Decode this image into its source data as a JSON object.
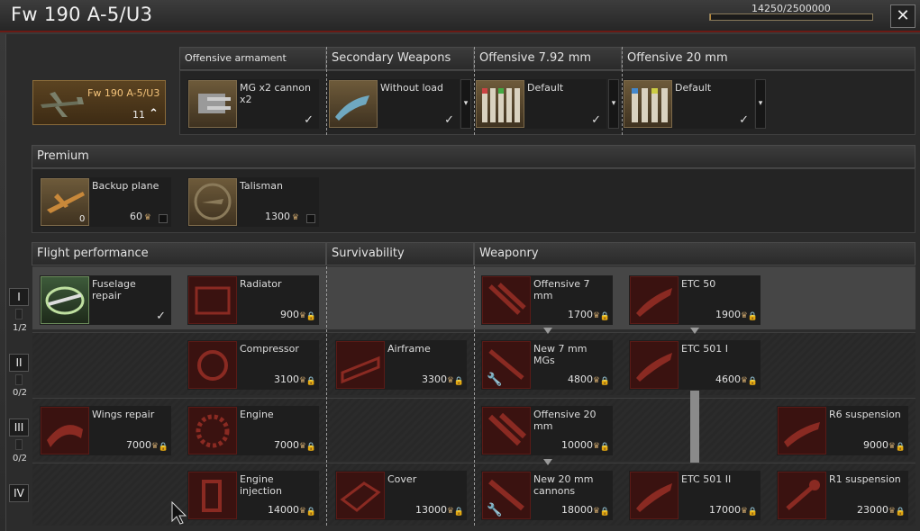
{
  "title": "Fw 190 A-5/U3",
  "xp": {
    "text": "14250/2500000",
    "fraction": 0.0057
  },
  "close_label": "✕",
  "plane": {
    "name": "Fw 190 A-5/U3",
    "rank": "11"
  },
  "weapons_headers": [
    "Offensive armament",
    "Secondary Weapons",
    "Offensive 7.92 mm",
    "Offensive 20 mm"
  ],
  "weapons": [
    {
      "name": "MG x2 cannon x2"
    },
    {
      "name": "Without load"
    },
    {
      "name": "Default"
    },
    {
      "name": "Default"
    }
  ],
  "premium": {
    "header": "Premium",
    "items": [
      {
        "name": "Backup plane",
        "cost": "60",
        "count": "0"
      },
      {
        "name": "Talisman",
        "cost": "1300"
      }
    ]
  },
  "modifications": {
    "headers": [
      "Flight performance",
      "Survivability",
      "Weaponry"
    ],
    "tiers": [
      "I",
      "II",
      "III",
      "IV"
    ],
    "tier_progress": [
      "1/2",
      "0/2",
      "0/2"
    ],
    "items": [
      {
        "name": "Fuselage repair",
        "cost": ""
      },
      {
        "name": "Radiator",
        "cost": "900"
      },
      {
        "name": "Offensive 7 mm",
        "cost": "1700"
      },
      {
        "name": "ETC 50",
        "cost": "1900"
      },
      {
        "name": "Compressor",
        "cost": "3100"
      },
      {
        "name": "Airframe",
        "cost": "3300"
      },
      {
        "name": "New 7 mm MGs",
        "cost": "4800"
      },
      {
        "name": "ETC 501 I",
        "cost": "4600"
      },
      {
        "name": "Wings repair",
        "cost": "7000"
      },
      {
        "name": "Engine",
        "cost": "7000"
      },
      {
        "name": "Offensive 20 mm",
        "cost": "10000"
      },
      {
        "name": "R6 suspension",
        "cost": "9000"
      },
      {
        "name": "Engine injection",
        "cost": "14000"
      },
      {
        "name": "Cover",
        "cost": "13000"
      },
      {
        "name": "New 20 mm cannons",
        "cost": "18000"
      },
      {
        "name": "ETC 501 II",
        "cost": "17000"
      },
      {
        "name": "R1 suspension",
        "cost": "23000"
      }
    ]
  },
  "colors": {
    "accent": "#6b1a14",
    "premium_gold": "#c9a36a",
    "xp_fill": "#b98a3c"
  }
}
